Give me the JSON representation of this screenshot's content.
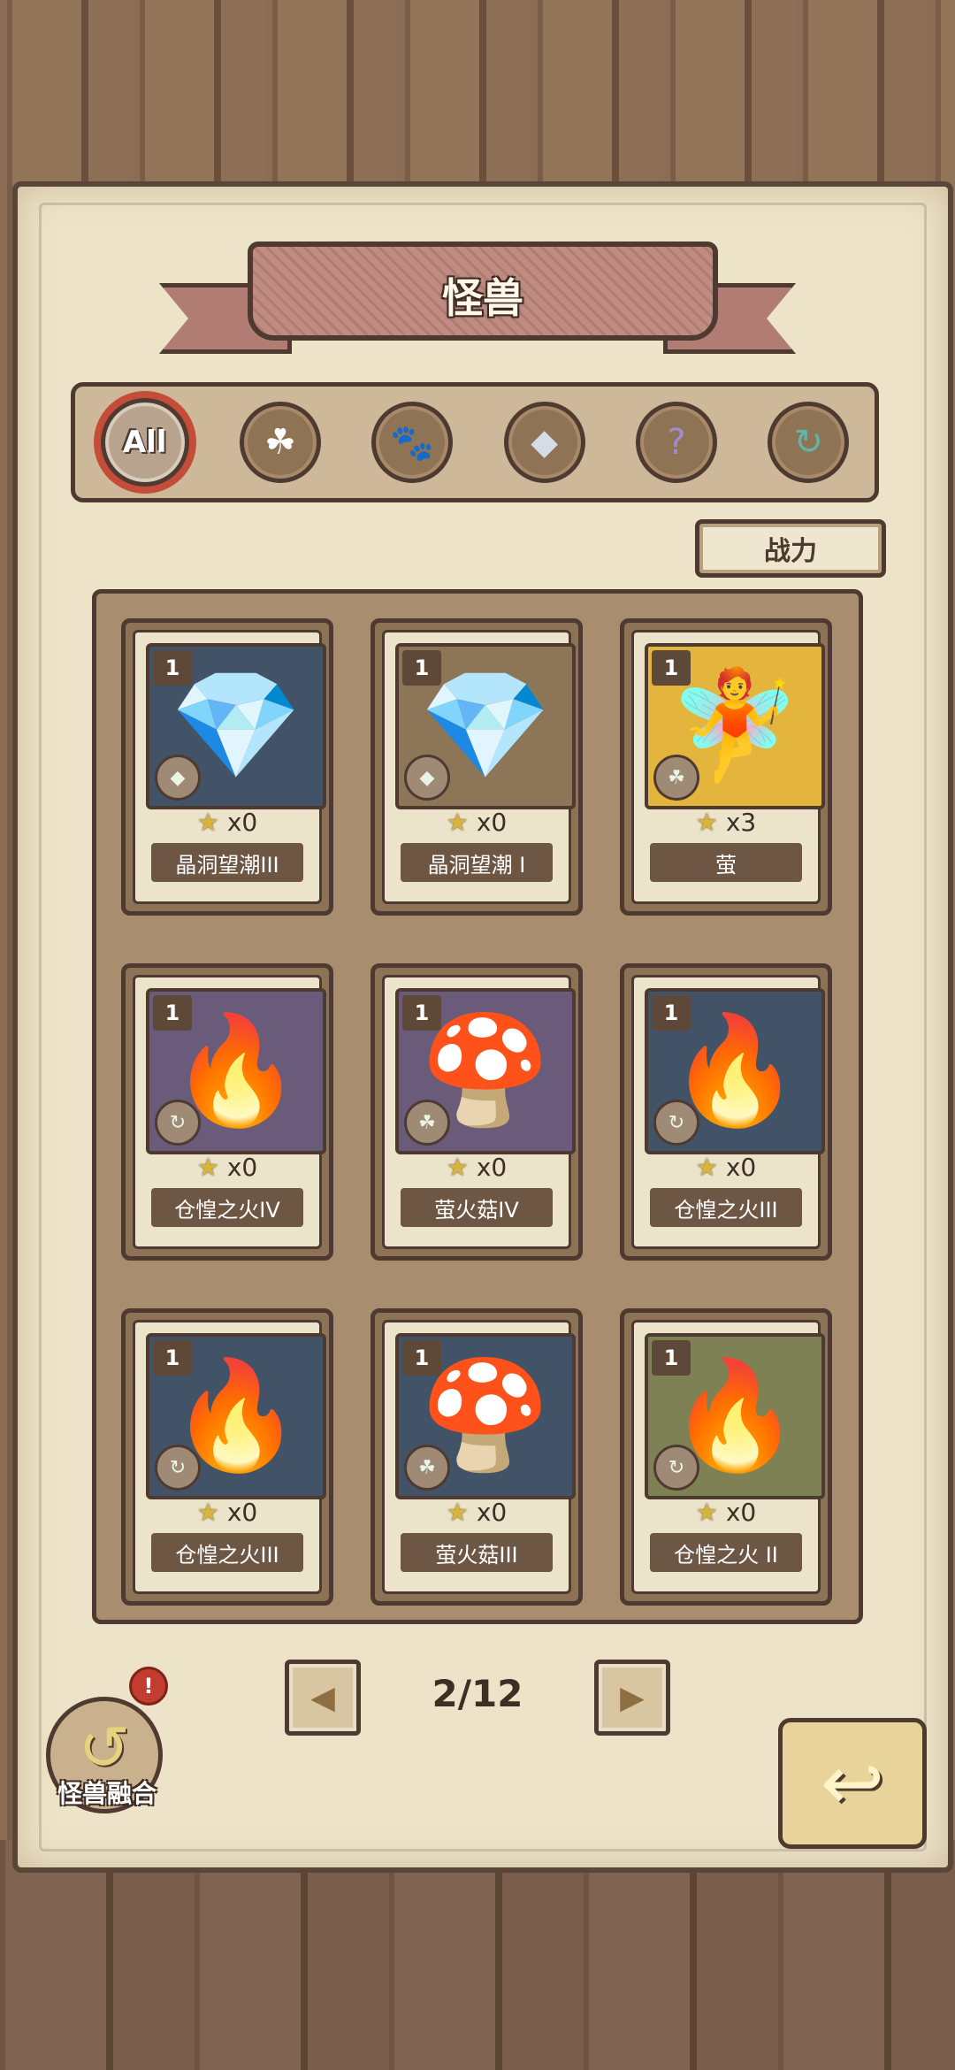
{
  "header": {
    "title": "怪兽"
  },
  "filters": [
    {
      "label": "All",
      "icon": "all-icon",
      "active": true
    },
    {
      "label": "",
      "icon": "leaf-icon"
    },
    {
      "label": "",
      "icon": "paw-icon"
    },
    {
      "label": "",
      "icon": "crystal-icon"
    },
    {
      "label": "",
      "icon": "question-icon"
    },
    {
      "label": "",
      "icon": "swirl-icon"
    }
  ],
  "sort": {
    "label": "战力"
  },
  "cards": [
    {
      "level": "1",
      "stars": "x0",
      "name": "晶洞望潮III",
      "element_icon": "crystal-icon",
      "art": "crystal-octopus"
    },
    {
      "level": "1",
      "stars": "x0",
      "name": "晶洞望潮 I",
      "element_icon": "crystal-icon",
      "art": "crystal-octopus"
    },
    {
      "level": "1",
      "stars": "x3",
      "name": "萤",
      "element_icon": "leaf-icon",
      "art": "mushroom-fairy"
    },
    {
      "level": "1",
      "stars": "x0",
      "name": "仓惶之火IV",
      "element_icon": "swirl-icon",
      "art": "fire-spirit"
    },
    {
      "level": "1",
      "stars": "x0",
      "name": "萤火菇IV",
      "element_icon": "leaf-icon",
      "art": "glow-mushroom"
    },
    {
      "level": "1",
      "stars": "x0",
      "name": "仓惶之火III",
      "element_icon": "swirl-icon",
      "art": "fire-spirit"
    },
    {
      "level": "1",
      "stars": "x0",
      "name": "仓惶之火III",
      "element_icon": "swirl-icon",
      "art": "fire-spirit"
    },
    {
      "level": "1",
      "stars": "x0",
      "name": "萤火菇III",
      "element_icon": "leaf-icon",
      "art": "glow-mushroom"
    },
    {
      "level": "1",
      "stars": "x0",
      "name": "仓惶之火 II",
      "element_icon": "swirl-icon",
      "art": "fire-spirit"
    }
  ],
  "pager": {
    "label": "2/12"
  },
  "fusion": {
    "label": "怪兽融合",
    "badge": "!"
  },
  "colors": {
    "accent": "#c44d3a",
    "paper": "#ede3c8",
    "ink": "#4e3a30"
  }
}
